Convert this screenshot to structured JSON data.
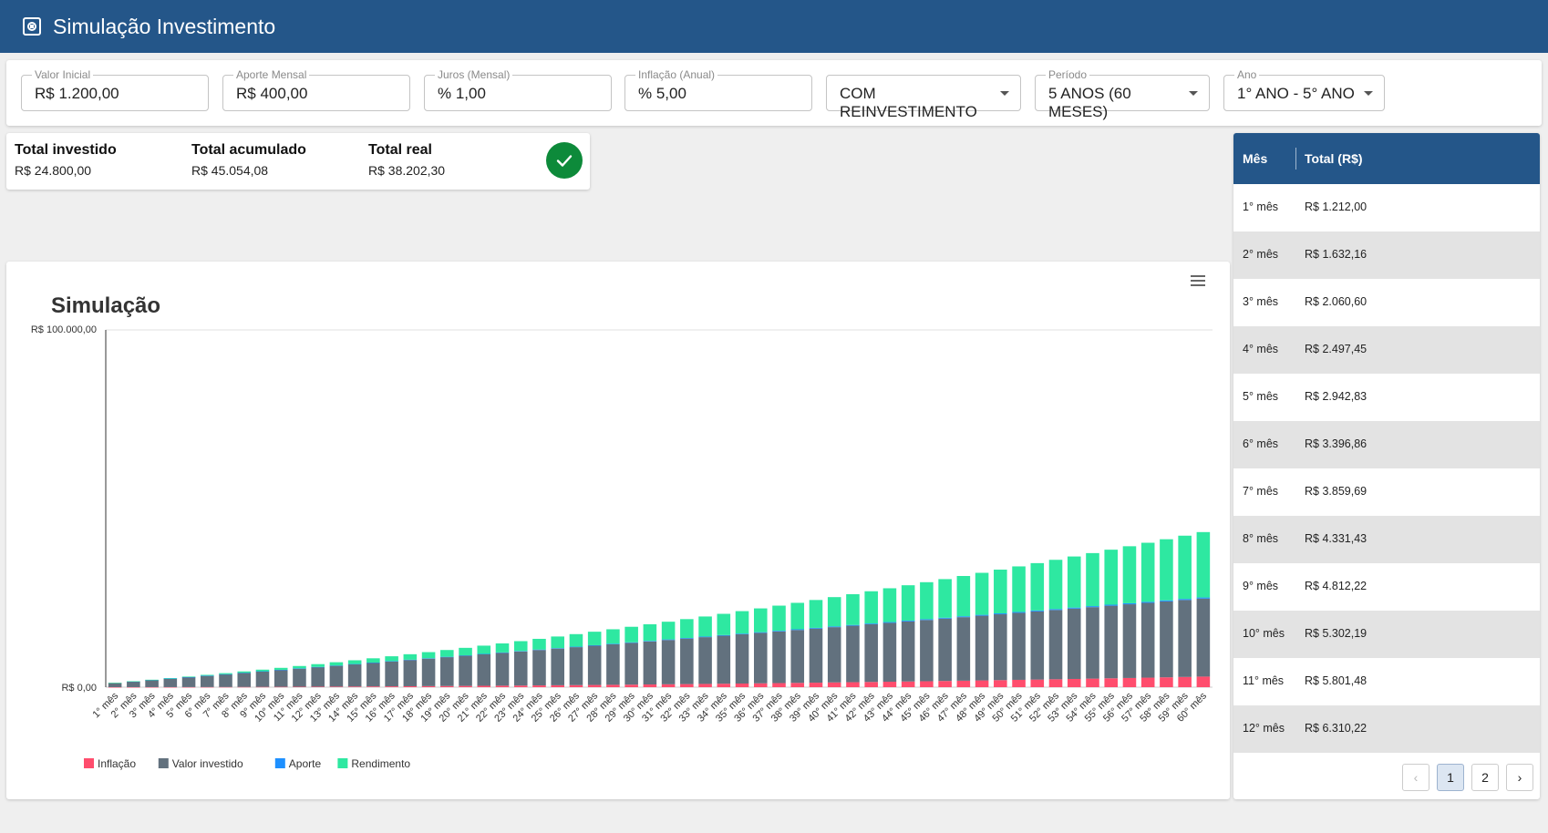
{
  "app": {
    "title": "Simulação Investimento",
    "icon": "calculator-icon"
  },
  "filters": {
    "valor_inicial": {
      "label": "Valor Inicial",
      "value": "R$ 1.200,00"
    },
    "aporte_mensal": {
      "label": "Aporte Mensal",
      "value": "R$ 400,00"
    },
    "juros": {
      "label": "Juros (Mensal)",
      "value": "% 1,00"
    },
    "inflacao": {
      "label": "Inflação (Anual)",
      "value": "% 5,00"
    },
    "reinvestimento": {
      "value": "COM REINVESTIMENTO"
    },
    "periodo": {
      "label": "Período",
      "value": "5 ANOS (60 MESES)"
    },
    "ano": {
      "label": "Ano",
      "value": "1° ANO - 5° ANO"
    }
  },
  "summary": {
    "total_investido": {
      "label": "Total investido",
      "value": "R$ 24.800,00"
    },
    "total_acumulado": {
      "label": "Total acumulado",
      "value": "R$ 45.054,08"
    },
    "total_real": {
      "label": "Total real",
      "value": "R$ 38.202,30"
    },
    "status_icon": "check-icon",
    "status_color": "#0d8a3a"
  },
  "table": {
    "headers": [
      "Mês",
      "Total (R$)"
    ],
    "rows": [
      [
        "1° mês",
        "R$ 1.212,00"
      ],
      [
        "2° mês",
        "R$ 1.632,16"
      ],
      [
        "3° mês",
        "R$ 2.060,60"
      ],
      [
        "4° mês",
        "R$ 2.497,45"
      ],
      [
        "5° mês",
        "R$ 2.942,83"
      ],
      [
        "6° mês",
        "R$ 3.396,86"
      ],
      [
        "7° mês",
        "R$ 3.859,69"
      ],
      [
        "8° mês",
        "R$ 4.331,43"
      ],
      [
        "9° mês",
        "R$ 4.812,22"
      ],
      [
        "10° mês",
        "R$ 5.302,19"
      ],
      [
        "11° mês",
        "R$ 5.801,48"
      ],
      [
        "12° mês",
        "R$ 6.310,22"
      ]
    ],
    "pages": [
      "1",
      "2"
    ],
    "current_page": "1",
    "prev_label": "‹",
    "next_label": "›"
  },
  "colors": {
    "header": "#245689",
    "inflacao": "#ff4d6d",
    "valor_investido": "#62717e",
    "aporte": "#1e90ff",
    "rendimento": "#2ee8a1"
  },
  "chart_data": {
    "type": "bar",
    "stacked": true,
    "title": "Simulação",
    "ylim": [
      0,
      100000
    ],
    "y_tick_labels": [
      "R$ 0,00",
      "R$ 100.000,00"
    ],
    "categories": [
      "1° mês",
      "2° mês",
      "3° mês",
      "4° mês",
      "5° mês",
      "6° mês",
      "7° mês",
      "8° mês",
      "9° mês",
      "10° mês",
      "11° mês",
      "12° mês",
      "13° mês",
      "14° mês",
      "15° mês",
      "16° mês",
      "17° mês",
      "18° mês",
      "19° mês",
      "20° mês",
      "21° mês",
      "22° mês",
      "23° mês",
      "24° mês",
      "25° mês",
      "26° mês",
      "27° mês",
      "28° mês",
      "29° mês",
      "30° mês",
      "31° mês",
      "32° mês",
      "33° mês",
      "34° mês",
      "35° mês",
      "36° mês",
      "37° mês",
      "38° mês",
      "39° mês",
      "40° mês",
      "41° mês",
      "42° mês",
      "43° mês",
      "44° mês",
      "45° mês",
      "46° mês",
      "47° mês",
      "48° mês",
      "49° mês",
      "50° mês",
      "51° mês",
      "52° mês",
      "53° mês",
      "54° mês",
      "55° mês",
      "56° mês",
      "57° mês",
      "58° mês",
      "59° mês",
      "60° mês"
    ],
    "legend": {
      "position": "bottom-left"
    },
    "series": [
      {
        "name": "Inflação",
        "values": [
          5,
          10,
          15,
          20,
          30,
          40,
          55,
          70,
          85,
          100,
          120,
          140,
          160,
          180,
          205,
          230,
          260,
          290,
          320,
          350,
          385,
          420,
          455,
          495,
          535,
          575,
          620,
          665,
          710,
          760,
          810,
          860,
          910,
          965,
          1020,
          1080,
          1140,
          1200,
          1260,
          1325,
          1390,
          1455,
          1525,
          1595,
          1665,
          1740,
          1815,
          1890,
          1970,
          2050,
          2130,
          2215,
          2300,
          2390,
          2480,
          2570,
          2665,
          2760,
          2860,
          2960
        ]
      },
      {
        "name": "Valor investido",
        "values": [
          1195,
          1590,
          1985,
          2380,
          2770,
          3160,
          3545,
          3930,
          4315,
          4700,
          5080,
          5460,
          5840,
          6220,
          6595,
          6970,
          7340,
          7710,
          8080,
          8450,
          8815,
          9180,
          9545,
          9905,
          10265,
          10625,
          10980,
          11335,
          11690,
          12040,
          12390,
          12740,
          13090,
          13435,
          13780,
          14120,
          14460,
          14800,
          15140,
          15475,
          15810,
          16145,
          16475,
          16805,
          17135,
          17460,
          17785,
          18110,
          18430,
          18750,
          19070,
          19385,
          19700,
          20010,
          20320,
          20630,
          20935,
          21240,
          21540,
          21840
        ]
      },
      {
        "name": "Aporte",
        "values": [
          0,
          20,
          25,
          30,
          35,
          40,
          45,
          50,
          55,
          60,
          65,
          70,
          75,
          80,
          85,
          90,
          95,
          100,
          105,
          110,
          115,
          120,
          125,
          130,
          135,
          140,
          145,
          150,
          155,
          160,
          165,
          170,
          175,
          180,
          185,
          190,
          195,
          200,
          205,
          210,
          215,
          220,
          225,
          230,
          235,
          240,
          245,
          250,
          255,
          260,
          265,
          270,
          275,
          280,
          285,
          290,
          295,
          300,
          305,
          310
        ]
      },
      {
        "name": "Rendimento",
        "values": [
          12,
          30,
          60,
          100,
          150,
          210,
          280,
          360,
          450,
          550,
          660,
          780,
          910,
          1050,
          1200,
          1360,
          1530,
          1710,
          1900,
          2100,
          2310,
          2530,
          2760,
          3000,
          3250,
          3510,
          3780,
          4060,
          4350,
          4650,
          4960,
          5280,
          5610,
          5950,
          6300,
          6660,
          7030,
          7410,
          7800,
          8200,
          8610,
          9030,
          9460,
          9900,
          10350,
          10810,
          11280,
          11760,
          12250,
          12750,
          13260,
          13780,
          14310,
          14850,
          15400,
          15960,
          16530,
          17110,
          17700,
          18300
        ]
      }
    ]
  }
}
